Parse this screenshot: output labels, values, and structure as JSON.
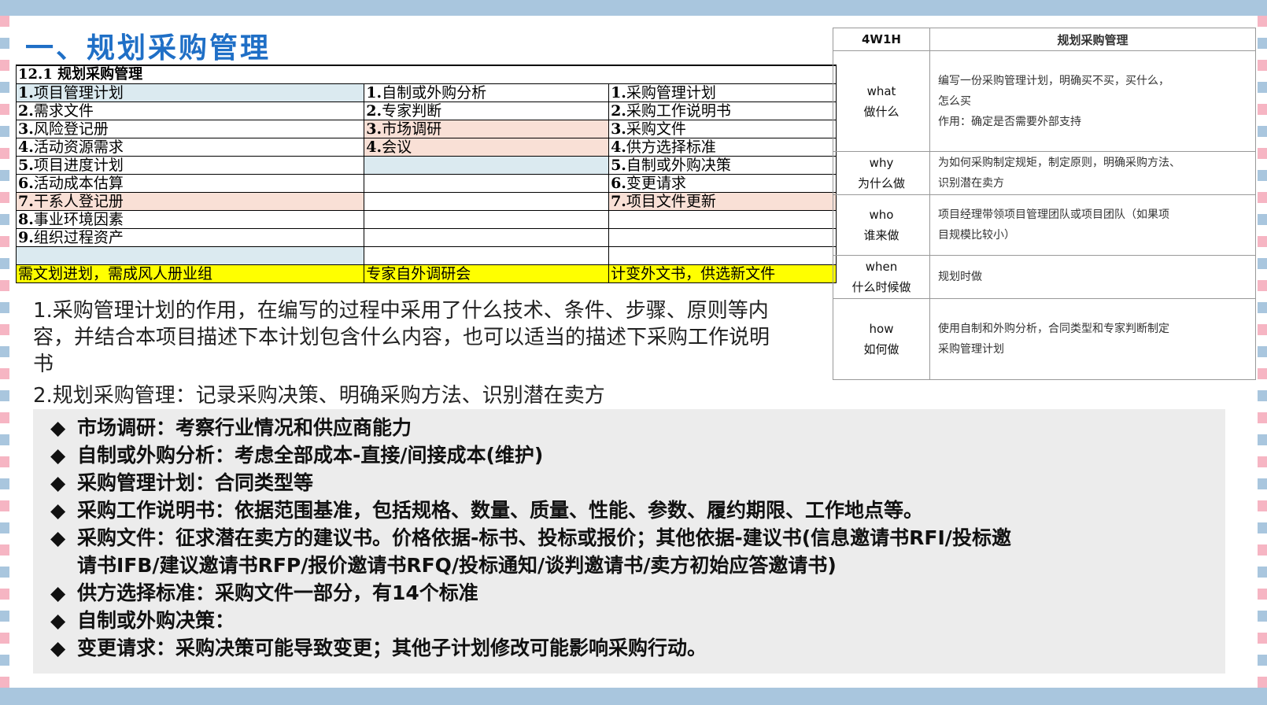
{
  "title": "一、规划采购管理",
  "itto": {
    "heading": "12.1 规划采购管理",
    "rows": [
      {
        "c1n": "1.",
        "c1": "项目管理计划",
        "c2n": "1.",
        "c2": "自制或外购分析",
        "c3n": "1.",
        "c3": "采购管理计划"
      },
      {
        "c1n": "2.",
        "c1": "需求文件",
        "c2n": "2.",
        "c2": "专家判断",
        "c3n": "2.",
        "c3": "采购工作说明书"
      },
      {
        "c1n": "3.",
        "c1": "风险登记册",
        "c2n": "3.",
        "c2": "市场调研",
        "c3n": "3.",
        "c3": "采购文件"
      },
      {
        "c1n": "4.",
        "c1": "活动资源需求",
        "c2n": "4.",
        "c2": "会议",
        "c3n": "4.",
        "c3": "供方选择标准"
      },
      {
        "c1n": "5.",
        "c1": "项目进度计划",
        "c2n": "",
        "c2": "",
        "c3n": "5.",
        "c3": "自制或外购决策"
      },
      {
        "c1n": "6.",
        "c1": "活动成本估算",
        "c2n": "",
        "c2": "",
        "c3n": "6.",
        "c3": "变更请求"
      },
      {
        "c1n": "7.",
        "c1": "干系人登记册",
        "c2n": "",
        "c2": "",
        "c3n": "7.",
        "c3": "项目文件更新"
      },
      {
        "c1n": "8.",
        "c1": "事业环境因素",
        "c2n": "",
        "c2": "",
        "c3n": "",
        "c3": ""
      },
      {
        "c1n": "9.",
        "c1": "组织过程资产",
        "c2n": "",
        "c2": "",
        "c3n": "",
        "c3": ""
      }
    ],
    "summary": [
      "需文划进划，需成风人册业组",
      "专家自外调研会",
      "计变外文书，供选新文件"
    ]
  },
  "questions": {
    "q1": "1.采购管理计划的作用，在编写的过程中采用了什么技术、条件、步骤、原则等内容，并结合本项目描述下本计划包含什么内容，也可以适当的描述下采购工作说明书",
    "q2": "2.规划采购管理：记录采购决策、明确采购方法、识别潜在卖方"
  },
  "bullets": {
    "marker": "◆",
    "items": [
      "市场调研：考察行业情况和供应商能力",
      "自制或外购分析：考虑全部成本-直接/间接成本(维护)",
      "采购管理计划：合同类型等",
      "采购工作说明书：依据范围基准，包括规格、数量、质量、性能、参数、履约期限、工作地点等。",
      "采购文件：征求潜在卖方的建议书。价格依据-标书、投标或报价；其他依据-建议书(信息邀请书RFI/投标邀",
      "请书IFB/建议邀请书RFP/报价邀请书RFQ/投标通知/谈判邀请书/卖方初始应答邀请书)",
      "供方选择标准：采购文件一部分，有14个标准",
      "自制或外购决策：",
      "变更请求：采购决策可能导致变更；其他子计划修改可能影响采购行动。"
    ]
  },
  "w4h1": {
    "col1": "4W1H",
    "col2": "规划采购管理",
    "rows": [
      {
        "en": "what",
        "zh": "做什么",
        "lines": [
          "编写一份采购管理计划，明确买不买，买什么，",
          "怎么买",
          "作用：确定是否需要外部支持"
        ]
      },
      {
        "en": "why",
        "zh": "为什么做",
        "lines": [
          "为如何采购制定规矩，制定原则，明确采购方法、",
          "识别潜在卖方"
        ]
      },
      {
        "en": "who",
        "zh": "谁来做",
        "lines": [
          "项目经理带领项目管理团队或项目团队（如果项",
          "目规模比较小）"
        ]
      },
      {
        "en": "when",
        "zh": "什么时候做",
        "lines": [
          "规划时做"
        ]
      },
      {
        "en": "how",
        "zh": "如何做",
        "lines": [
          "使用自制和外购分析，合同类型和专家判断制定",
          "采购管理计划"
        ]
      }
    ]
  }
}
